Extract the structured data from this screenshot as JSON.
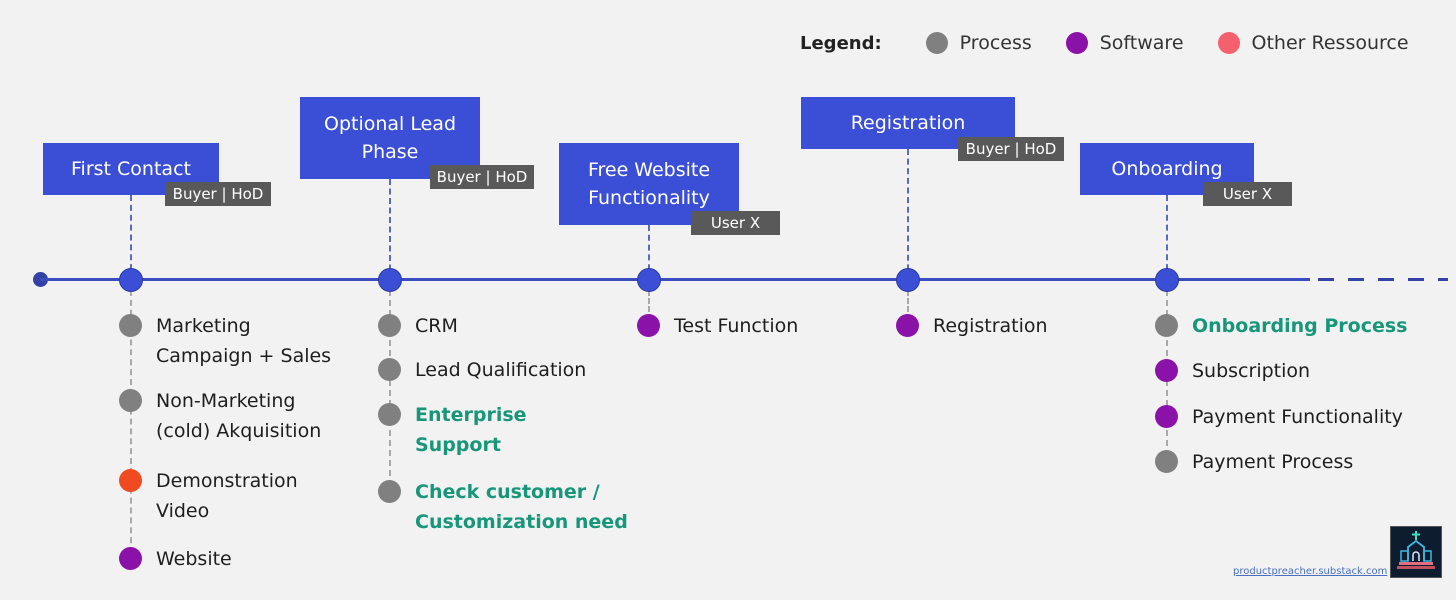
{
  "legend": {
    "title": "Legend:",
    "items": [
      {
        "label": "Process",
        "color": "#808080"
      },
      {
        "label": "Software",
        "color": "#8b12a8"
      },
      {
        "label": "Other Ressource",
        "color": "#f4606e"
      }
    ]
  },
  "colors": {
    "process": "#808080",
    "software": "#8b12a8",
    "other": "#f04a22",
    "phase": "#3b4fd6",
    "role": "#595959",
    "highlight": "#17967a"
  },
  "phases": [
    {
      "title": "First Contact",
      "role": "Buyer | HoD",
      "items": [
        {
          "label": "Marketing\nCampaign + Sales",
          "type": "process",
          "highlight": false
        },
        {
          "label": "Non-Marketing\n(cold) Akquisition",
          "type": "process",
          "highlight": false
        },
        {
          "label": "Demonstration\nVideo",
          "type": "other",
          "highlight": false
        },
        {
          "label": "Website",
          "type": "software",
          "highlight": false
        }
      ]
    },
    {
      "title": "Optional Lead\nPhase",
      "role": "Buyer | HoD",
      "items": [
        {
          "label": "CRM",
          "type": "process",
          "highlight": false
        },
        {
          "label": "Lead Qualification",
          "type": "process",
          "highlight": false
        },
        {
          "label": "Enterprise\nSupport",
          "type": "process",
          "highlight": true
        },
        {
          "label": "Check customer /\nCustomization need",
          "type": "process",
          "highlight": true
        }
      ]
    },
    {
      "title": "Free Website\nFunctionality",
      "role": "User X",
      "items": [
        {
          "label": "Test Function",
          "type": "software",
          "highlight": false
        }
      ]
    },
    {
      "title": "Registration",
      "role": "Buyer | HoD",
      "items": [
        {
          "label": "Registration",
          "type": "software",
          "highlight": false
        }
      ]
    },
    {
      "title": "Onboarding",
      "role": "User X",
      "items": [
        {
          "label": "Onboarding Process",
          "type": "process",
          "highlight": true
        },
        {
          "label": "Subscription",
          "type": "software",
          "highlight": false
        },
        {
          "label": "Payment Functionality",
          "type": "software",
          "highlight": false
        },
        {
          "label": "Payment Process",
          "type": "process",
          "highlight": false
        }
      ]
    }
  ],
  "footer": {
    "link": "productpreacher.substack.com",
    "logo": "church-logo"
  }
}
